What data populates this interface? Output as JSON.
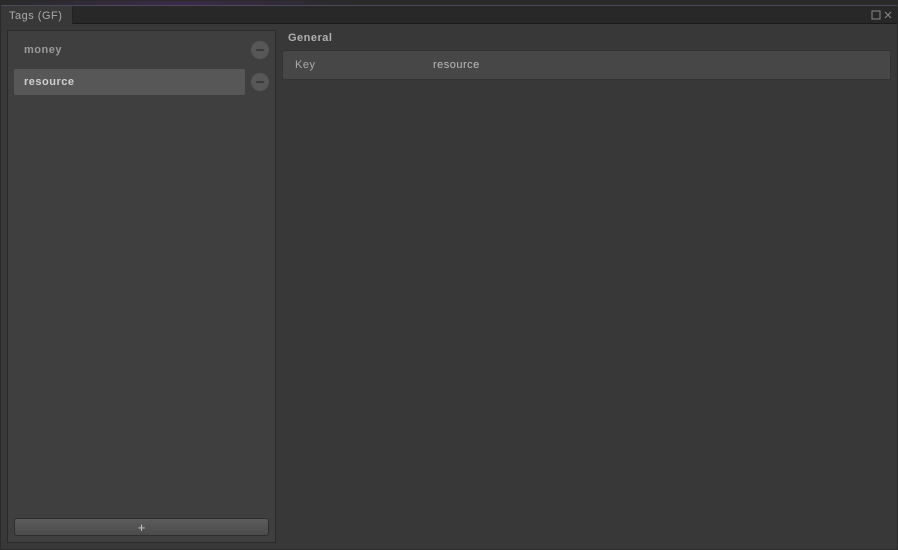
{
  "tab": {
    "title": "Tags (GF)"
  },
  "sidebar": {
    "tags": [
      {
        "label": "money",
        "selected": false
      },
      {
        "label": "resource",
        "selected": true
      }
    ],
    "add_label": "+"
  },
  "details": {
    "section_title": "General",
    "rows": [
      {
        "label": "Key",
        "value": "resource"
      }
    ]
  }
}
